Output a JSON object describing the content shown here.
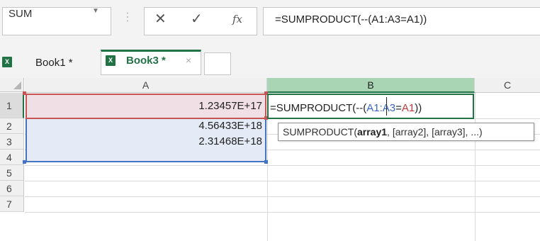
{
  "name_box": {
    "value": "SUM"
  },
  "formula_bar": {
    "cancel_icon": "close-icon",
    "enter_icon": "check-icon",
    "fx_label": "fx",
    "formula": "=SUMPRODUCT(--(A1:A3=A1))"
  },
  "workbook_tabs": [
    {
      "label": "Book1 *",
      "active": false
    },
    {
      "label": "Book3 *",
      "active": true,
      "close_glyph": "×"
    }
  ],
  "grid": {
    "column_headers": [
      "A",
      "B",
      "C"
    ],
    "row_headers": [
      "1",
      "2",
      "3",
      "4",
      "5",
      "6",
      "7"
    ],
    "cells": {
      "A1": "1.23457E+17",
      "A2": "4.56433E+18",
      "A3": "2.31468E+18"
    },
    "edit_cell": {
      "address": "B1",
      "prefix": "=SUMPRODUCT(--",
      "open_paren": "(",
      "range_ref": "A1:A3",
      "equals": "=",
      "cell_ref": "A1",
      "close_parens": "))"
    },
    "tooltip": {
      "function": "SUMPRODUCT(",
      "arg_current": "array1",
      "rest": ", [array2], [array3], ...)"
    }
  },
  "colors": {
    "accent_green": "#217346",
    "ref_blue": "#4472c4",
    "ref_red": "#c85454"
  }
}
